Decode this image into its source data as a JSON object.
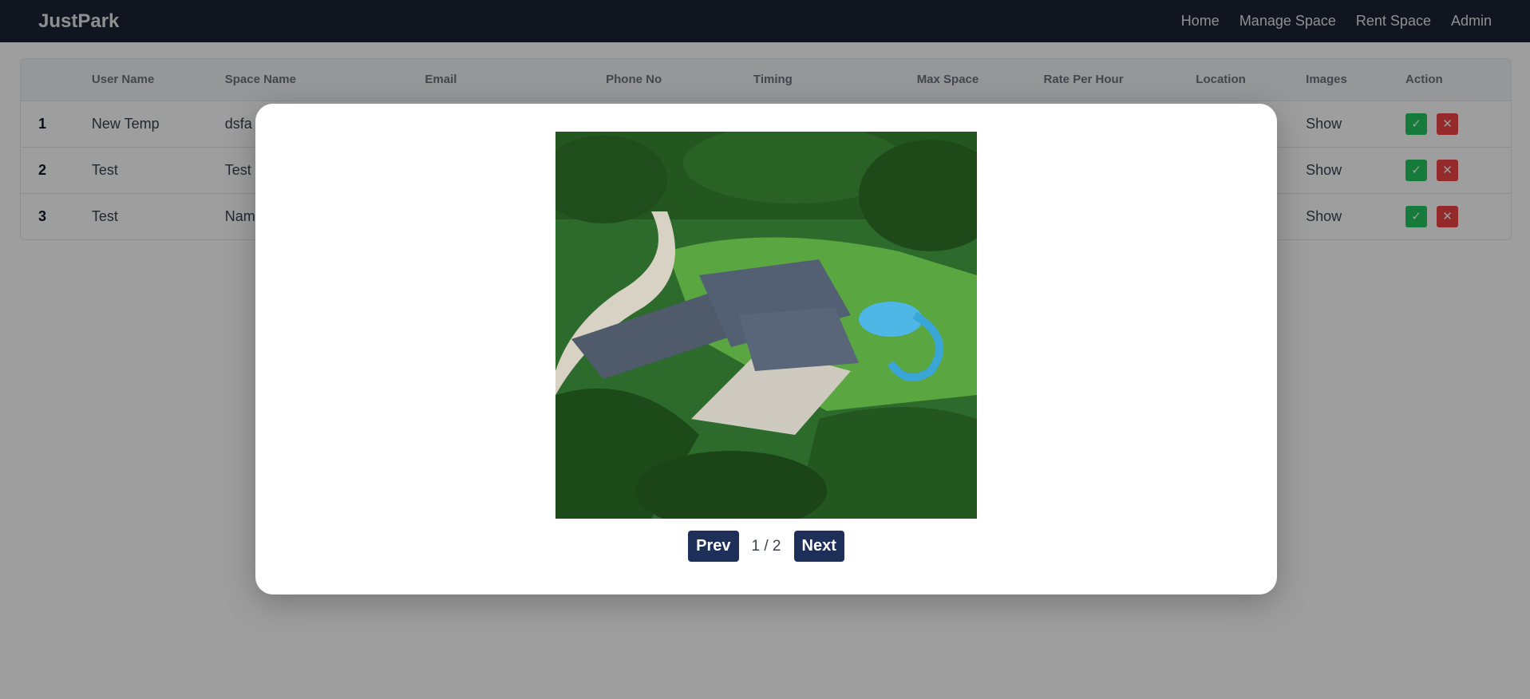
{
  "navbar": {
    "brand": "JustPark",
    "links": [
      "Home",
      "Manage Space",
      "Rent Space",
      "Admin"
    ]
  },
  "table": {
    "headers": [
      "",
      "User Name",
      "Space Name",
      "Email",
      "Phone No",
      "Timing",
      "Max Space",
      "Rate Per Hour",
      "Location",
      "Images",
      "Action"
    ],
    "rows": [
      {
        "num": "1",
        "user": "New Temp",
        "space": "dsfa",
        "images": "Show"
      },
      {
        "num": "2",
        "user": "Test",
        "space": "Test I",
        "images": "Show"
      },
      {
        "num": "3",
        "user": "Test",
        "space": "Nam",
        "images": "Show"
      }
    ],
    "approve_icon": "check-icon",
    "reject_icon": "close-icon"
  },
  "modal": {
    "image_alt": "aerial view of estate",
    "prev_label": "Prev",
    "next_label": "Next",
    "counter": "1 / 2"
  },
  "colors": {
    "navbar": "#1a2332",
    "approve": "#22c55e",
    "reject": "#ef4444",
    "pager_button": "#1e2f5a"
  }
}
